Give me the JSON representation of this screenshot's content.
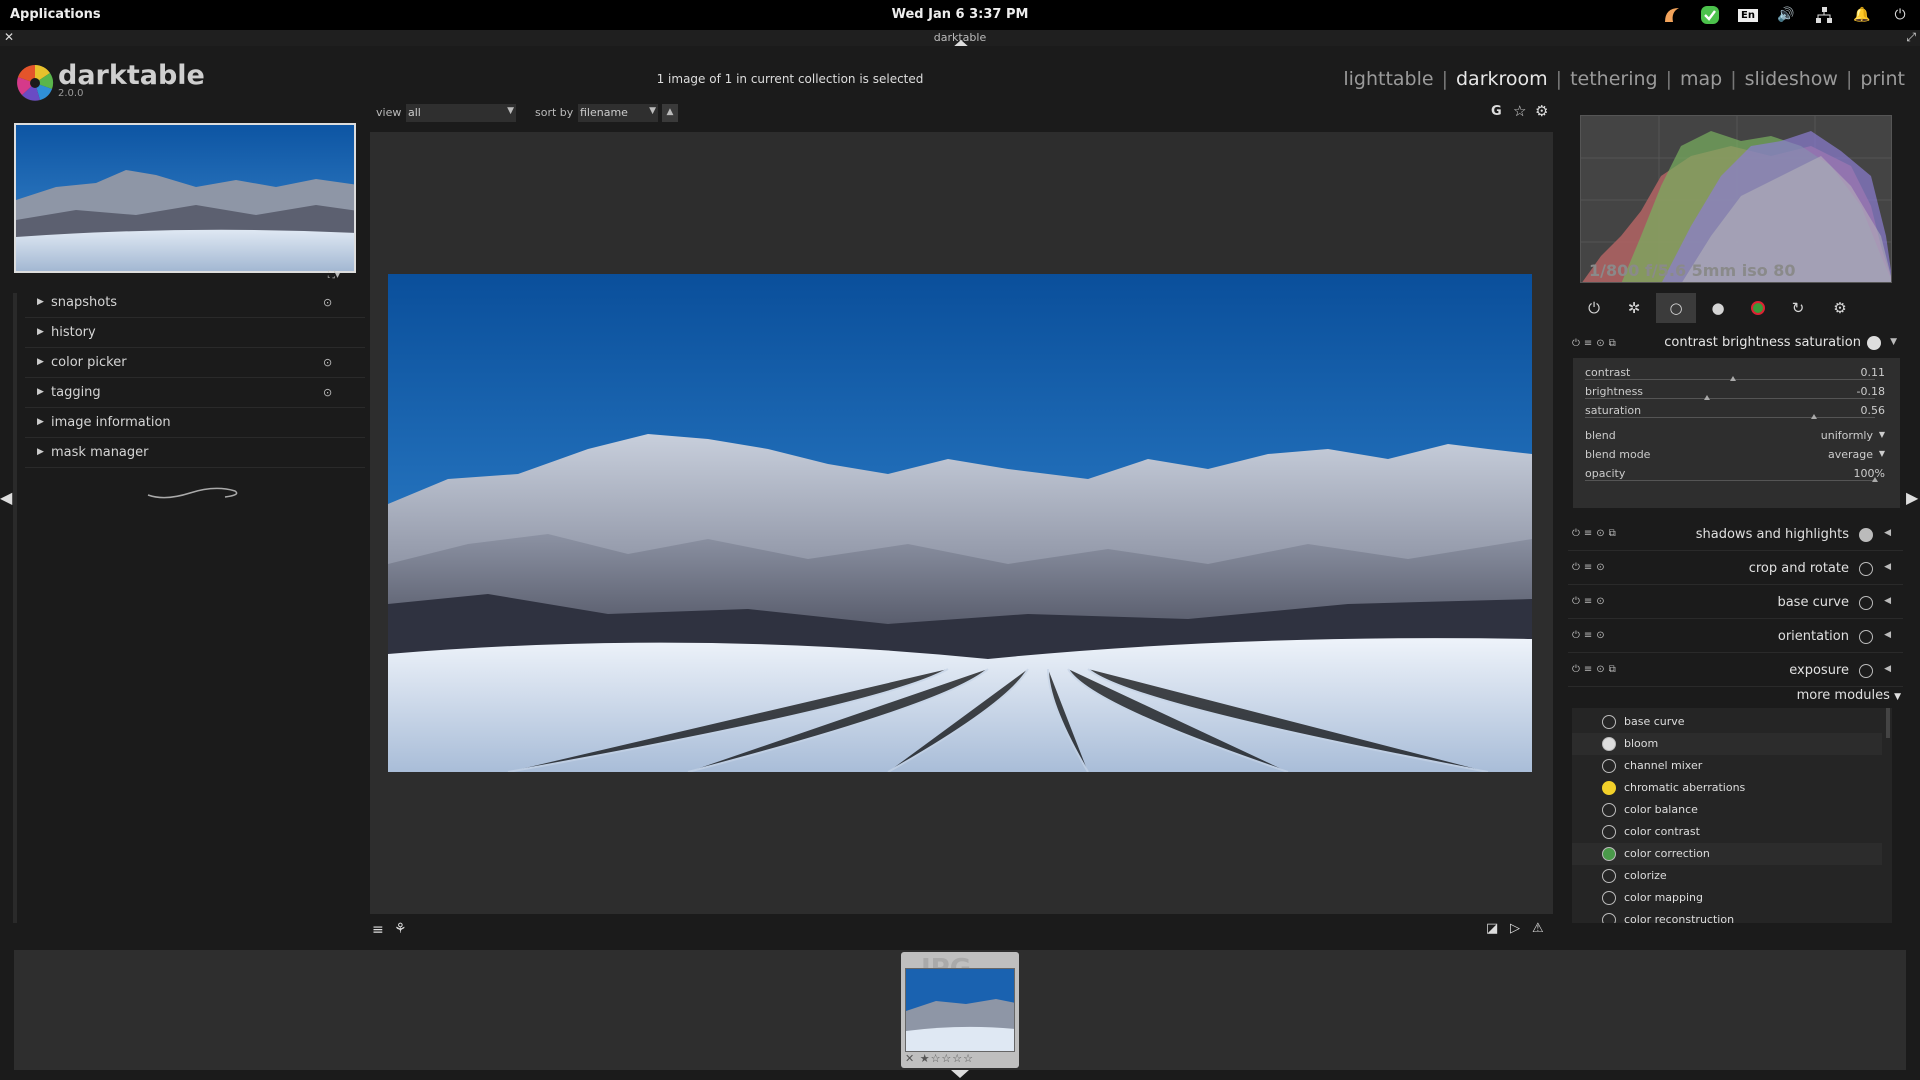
{
  "system": {
    "applications": "Applications",
    "clock": "Wed Jan  6    3:37 PM",
    "tray_lang": "En"
  },
  "window": {
    "title": "darktable"
  },
  "header": {
    "logo_text": "darktable",
    "version": "2.0.0",
    "status": "1 image of 1 in current collection is selected",
    "views": [
      "lighttable",
      "darkroom",
      "tethering",
      "map",
      "slideshow",
      "print"
    ],
    "active_view": "darkroom"
  },
  "toolbar": {
    "view_label": "view",
    "view_value": "all",
    "sort_label": "sort by",
    "sort_value": "filename",
    "g_label": "G"
  },
  "left_panel": {
    "items": [
      {
        "label": "snapshots",
        "pinned": true
      },
      {
        "label": "history",
        "pinned": false
      },
      {
        "label": "color picker",
        "pinned": true
      },
      {
        "label": "tagging",
        "pinned": true
      },
      {
        "label": "image information",
        "pinned": false
      },
      {
        "label": "mask manager",
        "pinned": false
      }
    ]
  },
  "histogram": {
    "exif": "1/800 f/5.6 5mm iso 80"
  },
  "module_tabs": [
    "power-icon",
    "favorite-icon",
    "basic-group-icon",
    "tone-group-icon",
    "color-group-icon",
    "correct-group-icon",
    "effect-group-icon"
  ],
  "expanded_module": {
    "name": "contrast brightness saturation",
    "sliders": [
      {
        "label": "contrast",
        "value": "0.11",
        "pos": 0.5
      },
      {
        "label": "brightness",
        "value": "-0.18",
        "pos": 0.41
      },
      {
        "label": "saturation",
        "value": "0.56",
        "pos": 0.78
      }
    ],
    "blend_label": "blend",
    "blend_value": "uniformly",
    "blend_mode_label": "blend mode",
    "blend_mode_value": "average",
    "opacity_label": "opacity",
    "opacity_value": "100%"
  },
  "modules": [
    {
      "name": "shadows and highlights"
    },
    {
      "name": "crop and rotate"
    },
    {
      "name": "base curve"
    },
    {
      "name": "orientation"
    },
    {
      "name": "exposure"
    }
  ],
  "more_modules": {
    "label": "more modules",
    "items": [
      "base curve",
      "bloom",
      "channel mixer",
      "chromatic aberrations",
      "color balance",
      "color contrast",
      "color correction",
      "colorize",
      "color mapping",
      "color reconstruction"
    ]
  },
  "filmstrip": {
    "badge": "JPG",
    "stars": "✕ ★☆☆☆☆"
  }
}
